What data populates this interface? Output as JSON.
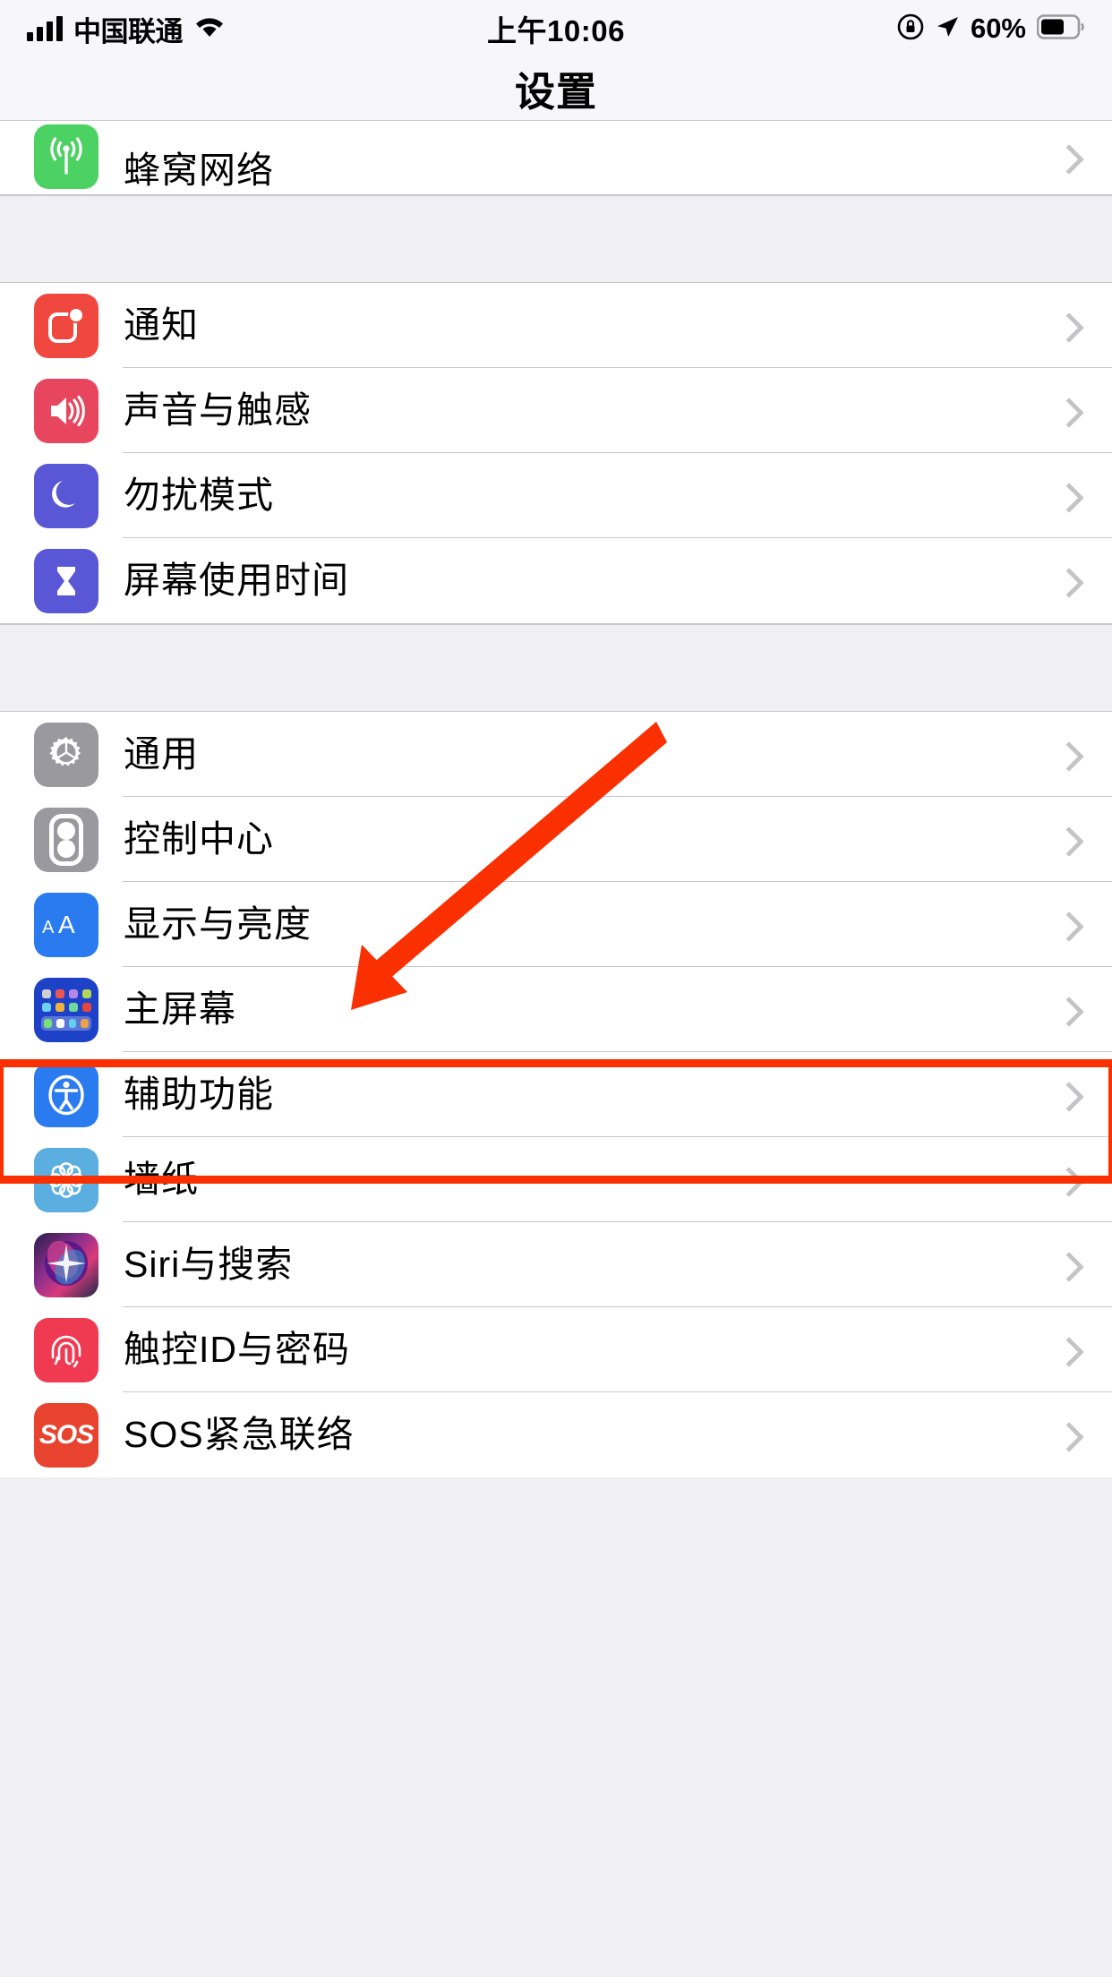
{
  "status_bar": {
    "carrier": "中国联通",
    "time": "上午10:06",
    "battery_percent": "60%",
    "signal_icon": "signal-bars-icon",
    "wifi_icon": "wifi-icon",
    "rotation_lock_icon": "rotation-lock-icon",
    "location_icon": "location-arrow-icon",
    "battery_icon": "battery-icon"
  },
  "navbar": {
    "title": "设置"
  },
  "groups": [
    {
      "id": "group-connectivity",
      "rows": [
        {
          "id": "cellular",
          "label": "蜂窝网络",
          "icon": "cellular-antenna-icon",
          "icon_class": "ic-cell",
          "partial": true
        }
      ]
    },
    {
      "id": "group-alerts",
      "rows": [
        {
          "id": "notifications",
          "label": "通知",
          "icon": "notifications-badge-icon",
          "icon_class": "ic-notif"
        },
        {
          "id": "sounds",
          "label": "声音与触感",
          "icon": "speaker-waves-icon",
          "icon_class": "ic-sound"
        },
        {
          "id": "do-not-disturb",
          "label": "勿扰模式",
          "icon": "crescent-moon-icon",
          "icon_class": "ic-dnd"
        },
        {
          "id": "screen-time",
          "label": "屏幕使用时间",
          "icon": "hourglass-icon",
          "icon_class": "ic-screentime"
        }
      ]
    },
    {
      "id": "group-system",
      "rows": [
        {
          "id": "general",
          "label": "通用",
          "icon": "gear-icon",
          "icon_class": "ic-general"
        },
        {
          "id": "control-center",
          "label": "控制中心",
          "icon": "toggles-icon",
          "icon_class": "ic-control",
          "highlighted": true
        },
        {
          "id": "display-brightness",
          "label": "显示与亮度",
          "icon": "text-size-aa-icon",
          "icon_class": "ic-display"
        },
        {
          "id": "home-screen",
          "label": "主屏幕",
          "icon": "app-grid-icon",
          "icon_class": "ic-home"
        },
        {
          "id": "accessibility",
          "label": "辅助功能",
          "icon": "accessibility-icon",
          "icon_class": "ic-access"
        },
        {
          "id": "wallpaper",
          "label": "墙纸",
          "icon": "flower-wallpaper-icon",
          "icon_class": "ic-wall"
        },
        {
          "id": "siri-search",
          "label": "Siri与搜索",
          "icon": "siri-orb-icon",
          "icon_class": "ic-siri"
        },
        {
          "id": "touch-id-passcode",
          "label": "触控ID与密码",
          "icon": "fingerprint-icon",
          "icon_class": "ic-touchid"
        },
        {
          "id": "emergency-sos",
          "label": "SOS紧急联络",
          "icon": "sos-icon",
          "icon_class": "ic-sos",
          "partial_bottom": true
        }
      ]
    }
  ],
  "annotations": {
    "arrow": {
      "name": "red-pointer-arrow",
      "color": "#fa3000",
      "points_to": "控制中心"
    },
    "highlight_box": {
      "name": "red-highlight-box",
      "color": "#fa3000",
      "around": "控制中心"
    }
  },
  "chevron_label": ">"
}
